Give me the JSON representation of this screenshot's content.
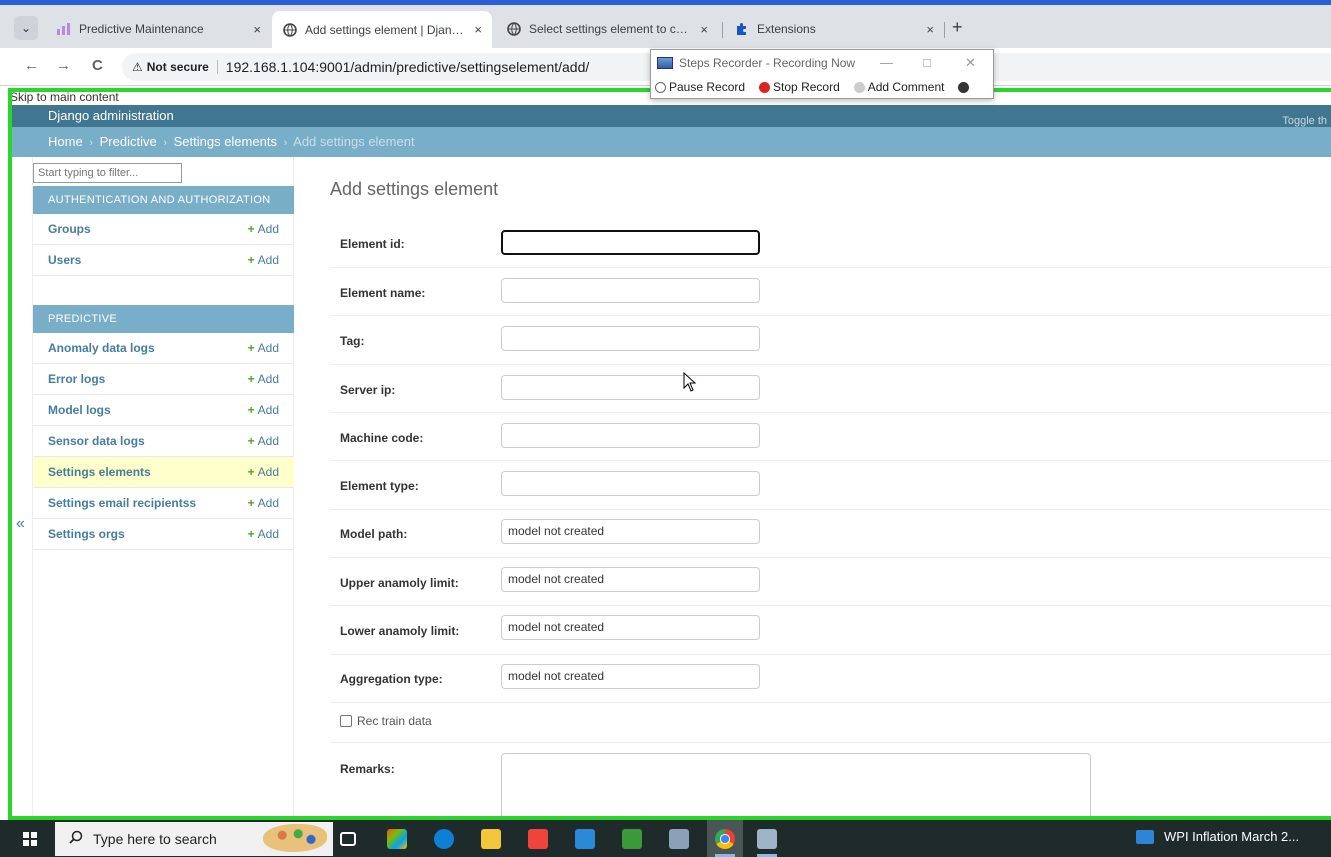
{
  "browser": {
    "tabs": [
      {
        "title": "Predictive Maintenance",
        "active": false
      },
      {
        "title": "Add settings element | Django site admin",
        "active": true
      },
      {
        "title": "Select settings element to change",
        "active": false
      },
      {
        "title": "Extensions",
        "active": false
      }
    ],
    "tab_close": "×",
    "new_tab": "+",
    "nav": {
      "back": "←",
      "forward": "→",
      "reload": "C"
    },
    "security_icon": "⚠",
    "security_label": "Not secure",
    "url": "192.168.1.104:9001/admin/predictive/settingselement/add/"
  },
  "recorder": {
    "title": "Steps Recorder - Recording Now",
    "controls": {
      "minimize": "—",
      "maximize": "□",
      "close": "✕"
    },
    "buttons": [
      "Pause Record",
      "Stop Record",
      "Add Comment"
    ]
  },
  "admin": {
    "skip_link": "Skip to main content",
    "brand": "Django administration",
    "toggle_theme": "Toggle th",
    "breadcrumbs": [
      "Home",
      "Predictive",
      "Settings elements"
    ],
    "breadcrumb_sep": "›",
    "breadcrumb_current": "Add settings element",
    "nav_filter_placeholder": "Start typing to filter...",
    "collapse_icon": "«",
    "add_label": "Add",
    "add_plus": "+",
    "apps": [
      {
        "caption": "Authentication and Authorization",
        "models": [
          "Groups",
          "Users"
        ]
      },
      {
        "caption": "Predictive",
        "models": [
          "Anomaly data logs",
          "Error logs",
          "Model logs",
          "Sensor data logs",
          "Settings elements",
          "Settings email recipientss",
          "Settings orgs"
        ]
      }
    ],
    "selected_model": "Settings elements"
  },
  "form": {
    "title": "Add settings element",
    "fields": [
      {
        "label": "Element id:",
        "value": "",
        "focused": true
      },
      {
        "label": "Element name:",
        "value": ""
      },
      {
        "label": "Tag:",
        "value": ""
      },
      {
        "label": "Server ip:",
        "value": ""
      },
      {
        "label": "Machine code:",
        "value": ""
      },
      {
        "label": "Element type:",
        "value": ""
      },
      {
        "label": "Model path:",
        "value": "model not created"
      },
      {
        "label": "Upper anamoly limit:",
        "value": "model not created"
      },
      {
        "label": "Lower anamoly limit:",
        "value": "model not created"
      },
      {
        "label": "Aggregation type:",
        "value": "model not created"
      }
    ],
    "checkbox_label": "Rec train data",
    "checkbox_checked": false,
    "remarks_label": "Remarks:"
  },
  "taskbar": {
    "search_placeholder": "Type here to search",
    "running_task": "WPI Inflation March 2...",
    "icons": [
      "windows-icon",
      "search-icon",
      "paint-palette-icon",
      "task-view-icon",
      "office-icon",
      "edge-icon",
      "file-explorer-icon",
      "anydesk-icon",
      "vscode-icon",
      "python-idle-icon",
      "app-icon",
      "chrome-icon",
      "steps-recorder-icon"
    ]
  },
  "colors": {
    "header": "#417690",
    "breadcrumbs": "#79aec8",
    "link": "#447e9b",
    "selected_row": "#ffffcc",
    "recording_frame": "#2bd62b",
    "taskbar": "#1f2b2b"
  }
}
